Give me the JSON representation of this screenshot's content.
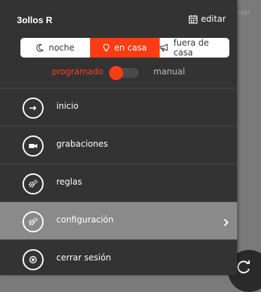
{
  "app": {
    "name": "3ollos R",
    "edit_label": "editar"
  },
  "background": {
    "partial_text": "nar"
  },
  "modes": [
    {
      "label": "noche",
      "icon": "moon-icon",
      "active": false
    },
    {
      "label": "en casa",
      "icon": "lightbulb-icon",
      "active": true
    },
    {
      "label": "fuera de casa",
      "icon": "megaphone-icon",
      "active": false
    }
  ],
  "schedule": {
    "left_label": "programado",
    "right_label": "manual",
    "selected": "programado"
  },
  "menu": {
    "items": [
      {
        "label": "inicio",
        "icon": "arrow-right-icon",
        "selected": false
      },
      {
        "label": "grabaciones",
        "icon": "video-camera-icon",
        "selected": false
      },
      {
        "label": "reglas",
        "icon": "gears-icon",
        "selected": false
      },
      {
        "label": "configuración",
        "icon": "gears-icon",
        "selected": true
      },
      {
        "label": "cerrar sesión",
        "icon": "logout-icon",
        "selected": false
      }
    ]
  },
  "colors": {
    "accent": "#ff3c14",
    "drawer_bg": "#333333",
    "selected_bg": "#8a8a8a",
    "overlay_bg": "#7a7a7a"
  }
}
